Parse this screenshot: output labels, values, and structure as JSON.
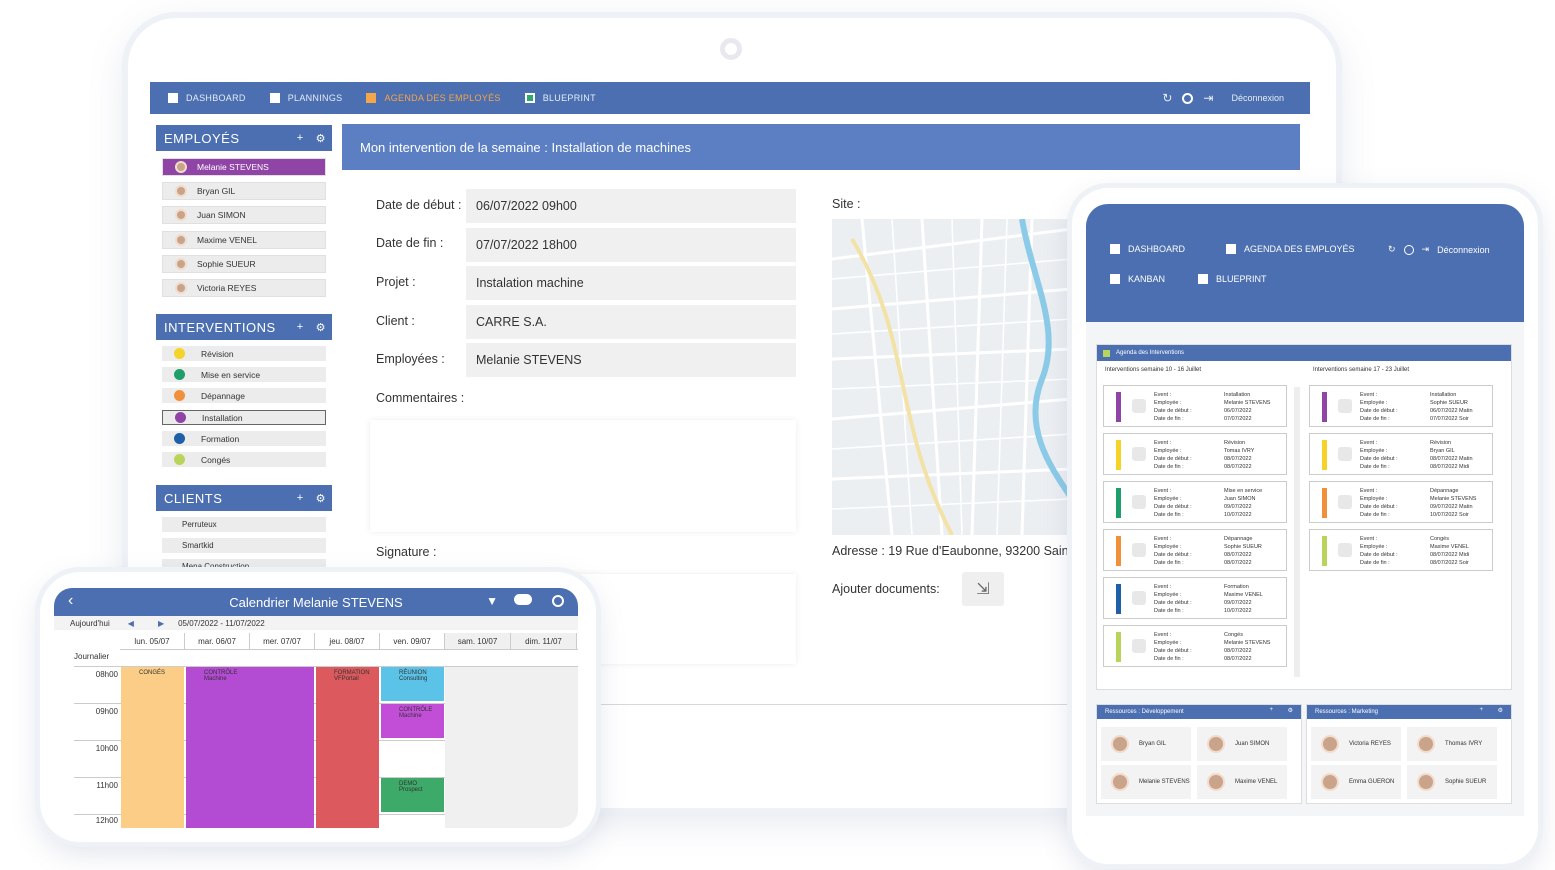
{
  "tablet": {
    "nav": [
      {
        "label": "DASHBOARD",
        "icon": "dashboard-icon"
      },
      {
        "label": "PLANNINGS",
        "icon": "plannings-icon"
      },
      {
        "label": "AGENDA DES EMPLOYÉS",
        "icon": "agenda-icon",
        "active": true
      },
      {
        "label": "BLUEPRINT",
        "icon": "blueprint-icon"
      }
    ],
    "logout": "Déconnexion",
    "employees_panel": {
      "title": "EMPLOYÉS",
      "items": [
        "Melanie STEVENS",
        "Bryan GIL",
        "Juan SIMON",
        "Maxime VENEL",
        "Sophie SUEUR",
        "Victoria REYES"
      ]
    },
    "interventions_panel": {
      "title": "INTERVENTIONS",
      "items": [
        {
          "label": "Révision",
          "color": "#f5d328"
        },
        {
          "label": "Mise en service",
          "color": "#1e9e6a"
        },
        {
          "label": "Dépannage",
          "color": "#f0903a"
        },
        {
          "label": "Installation",
          "color": "#8f44a6"
        },
        {
          "label": "Formation",
          "color": "#1f5fa8"
        },
        {
          "label": "Congés",
          "color": "#b9d45a"
        }
      ]
    },
    "clients_panel": {
      "title": "CLIENTS",
      "items": [
        "Perruteux",
        "Smartkid",
        "Mena Construction"
      ]
    },
    "banner": "Mon intervention de la semaine : Installation de machines",
    "form": {
      "start_label": "Date de début :",
      "start_value": "06/07/2022 09h00",
      "end_label": "Date de fin :",
      "end_value": "07/07/2022 18h00",
      "project_label": "Projet :",
      "project_value": "Instalation machine",
      "client_label": "Client :",
      "client_value": "CARRE S.A.",
      "employees_label": "Employées :",
      "employees_value": "Melanie STEVENS",
      "comments_label": "Commentaires :",
      "signature_label": "Signature :",
      "site_label": "Site :",
      "address": "Adresse :  19 Rue d'Eaubonne, 93200 Sain",
      "docs_label": "Ajouter documents:"
    }
  },
  "phone": {
    "title": "Calendrier Melanie STEVENS",
    "today": "Aujourd'hui",
    "range": "05/07/2022 - 11/07/2022",
    "days": [
      "lun. 05/07",
      "mar. 06/07",
      "mer. 07/07",
      "jeu. 08/07",
      "ven. 09/07",
      "sam. 10/07",
      "dim. 11/07"
    ],
    "journalier": "Journalier",
    "hours": [
      "08h00",
      "09h00",
      "10h00",
      "11h00",
      "12h00"
    ],
    "events": [
      {
        "title": "CONGÉS",
        "sub": ""
      },
      {
        "title": "CONTRÔLE",
        "sub": "Machine"
      },
      {
        "title": "FORMATION",
        "sub": "VFPortail"
      },
      {
        "title": "RÉUNION",
        "sub": "Consulting"
      },
      {
        "title": "CONTRÔLE",
        "sub": "Machine"
      },
      {
        "title": "DEMO",
        "sub": "Prospect"
      }
    ]
  },
  "small": {
    "nav": [
      "DASHBOARD",
      "AGENDA DES EMPLOYÉS",
      "KANBAN",
      "BLUEPRINT"
    ],
    "logout": "Déconnexion",
    "agenda_title": "Agenda des Interventions",
    "week1": "Interventions semaine 10 - 16 Juillet",
    "week2": "Interventions semaine 17 - 23 Juillet",
    "keys": [
      "Event :",
      "Employée :",
      "Date de début :",
      "Date de fin :"
    ],
    "col1": [
      {
        "v1": "Installation",
        "v2": "Melanie STEVENS",
        "v3": "06/07/2022",
        "v4": "07/07/2022",
        "color": "#8f44a6"
      },
      {
        "v1": "Révision",
        "v2": "Tomas IVRY",
        "v3": "08/07/2022",
        "v4": "08/07/2022",
        "color": "#f5d328"
      },
      {
        "v1": "Mise en service",
        "v2": "Juan SIMON",
        "v3": "09/07/2022",
        "v4": "10/07/2022",
        "color": "#1e9e6a"
      },
      {
        "v1": "Dépannage",
        "v2": "Sophie SUEUR",
        "v3": "08/07/2022",
        "v4": "08/07/2022",
        "color": "#f0903a"
      },
      {
        "v1": "Formation",
        "v2": "Maxime VENEL",
        "v3": "09/07/2022",
        "v4": "10/07/2022",
        "color": "#1f5fa8"
      },
      {
        "v1": "Congés",
        "v2": "Melanie STEVENS",
        "v3": "08/07/2022",
        "v4": "08/07/2022",
        "color": "#b9d45a"
      }
    ],
    "col2": [
      {
        "v1": "Installation",
        "v2": "Sophie SUEUR",
        "v3": "06/07/2022 Matin",
        "v4": "07/07/2022 Soir",
        "color": "#8f44a6"
      },
      {
        "v1": "Révision",
        "v2": "Bryan GIL",
        "v3": "08/07/2022 Matin",
        "v4": "08/07/2022 Midi",
        "color": "#f5d328"
      },
      {
        "v1": "Dépannage",
        "v2": "Melanie STEVENS",
        "v3": "09/07/2022 Matin",
        "v4": "10/07/2022 Soir",
        "color": "#f0903a"
      },
      {
        "v1": "Congés",
        "v2": "Maxime VENEL",
        "v3": "08/07/2022 Midi",
        "v4": "08/07/2022 Soir",
        "color": "#b9d45a"
      }
    ],
    "res_dev_title": "Ressources : Développement",
    "res_dev": [
      "Bryan GIL",
      "Juan SIMON",
      "Melanie STEVENS",
      "Maxime VENEL"
    ],
    "res_mkt_title": "Ressources : Marketing",
    "res_mkt": [
      "Victoria REYES",
      "Thomas IVRY",
      "Emma GUERON",
      "Sophie SUEUR"
    ]
  }
}
